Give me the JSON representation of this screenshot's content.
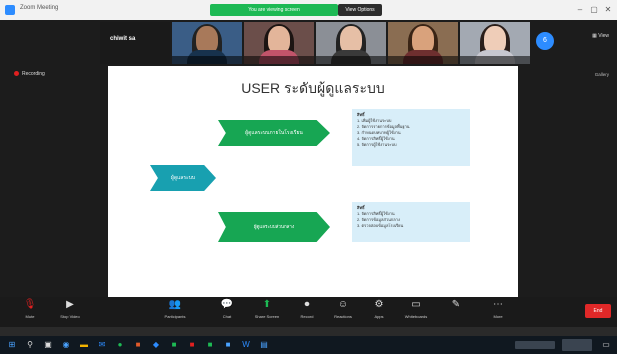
{
  "titlebar": {
    "title": "Zoom Meeting",
    "share_banner": "You are viewing screen",
    "view_options": "View Options"
  },
  "tiles": [
    {
      "name": "chiwit sa",
      "label": "chiwit sa"
    },
    {
      "name": "participant-2",
      "label": ""
    },
    {
      "name": "participant-3",
      "label": ""
    },
    {
      "name": "participant-4",
      "label": ""
    },
    {
      "name": "participant-5",
      "label": ""
    },
    {
      "name": "participant-6",
      "label": ""
    }
  ],
  "recording_label": "Recording",
  "view_label": "View",
  "gallery_label": "Gallery",
  "participant_count": "6",
  "slide": {
    "title": "USER ระดับผู้ดูแลระบบ",
    "center_arrow": "ผู้ดูแลระบบ",
    "top_arrow": "ผู้ดูแลระบบภายในโรงเรียน",
    "bottom_arrow": "ผู้ดูแลระบบส่วนกลาง",
    "box1_title": "สิทธิ์",
    "box1_lines": [
      "1. เพิ่มผู้ใช้งานระบบ",
      "2. จัดการรายการข้อมูลพื้นฐาน",
      "3. กำหนดบทบาทผู้ใช้งาน",
      "4. จัดการสิทธิ์ผู้ใช้งาน",
      "5. จัดการผู้ใช้งานระบบ"
    ],
    "box2_title": "สิทธิ์",
    "box2_lines": [
      "1. จัดการสิทธิ์ผู้ใช้งาน",
      "2. จัดการข้อมูลส่วนกลาง",
      "3. ตรวจสอบข้อมูลโรงเรียน"
    ]
  },
  "toolbar": {
    "mute": "Mute",
    "stop_video": "Stop Video",
    "participants": "Participants",
    "chat": "Chat",
    "share_screen": "Share Screen",
    "record": "Record",
    "reactions": "Reactions",
    "apps": "Apps",
    "whiteboards": "Whiteboards",
    "more": "More",
    "end": "End"
  }
}
